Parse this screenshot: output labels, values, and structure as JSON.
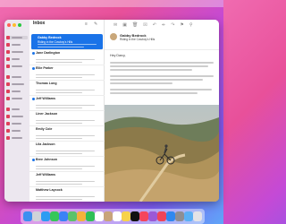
{
  "mail": {
    "mailbox_title": "Inbox",
    "mailbox_subtitle": "",
    "messages": [
      {
        "from": "Gabby Bedrock",
        "subject": "Riding in the Cowboy's Hills",
        "time": "",
        "selected": true,
        "unread": false
      },
      {
        "from": "Jane Darlington",
        "subject": "",
        "time": "",
        "selected": false,
        "unread": true
      },
      {
        "from": "Ellie Parker",
        "subject": "",
        "time": "",
        "selected": false,
        "unread": true
      },
      {
        "from": "Thomas Long",
        "subject": "",
        "time": "",
        "selected": false,
        "unread": false
      },
      {
        "from": "Jeff Williams",
        "subject": "",
        "time": "",
        "selected": false,
        "unread": true
      },
      {
        "from": "Liner Jackson",
        "subject": "",
        "time": "",
        "selected": false,
        "unread": false
      },
      {
        "from": "Emily Cole",
        "subject": "",
        "time": "",
        "selected": false,
        "unread": false
      },
      {
        "from": "Lila Jackson",
        "subject": "",
        "time": "",
        "selected": false,
        "unread": false
      },
      {
        "from": "Bree Johnson",
        "subject": "",
        "time": "",
        "selected": false,
        "unread": true
      },
      {
        "from": "Jeff Williams",
        "subject": "",
        "time": "",
        "selected": false,
        "unread": false
      },
      {
        "from": "Matthew Laycock",
        "subject": "",
        "time": "",
        "selected": false,
        "unread": false
      }
    ]
  },
  "reader": {
    "from": "Gabby Bedrock",
    "subject": "Riding in the Cowboy's Hills",
    "to": "",
    "greeting": "Hey Darcy,"
  },
  "colors": {
    "accent": "#1a73e8",
    "sidebar_icon": "#e0405a"
  },
  "dock_icons": [
    "finder-icon",
    "launchpad-icon",
    "safari-icon",
    "messages-icon",
    "mail-icon",
    "maps-icon",
    "photos-icon",
    "facetime-icon",
    "calendar-icon",
    "contacts-icon",
    "reminders-icon",
    "notes-icon",
    "tv-icon",
    "music-icon",
    "podcasts-icon",
    "news-icon",
    "appstore-icon",
    "settings-icon",
    "folder-icon",
    "trash-icon"
  ]
}
